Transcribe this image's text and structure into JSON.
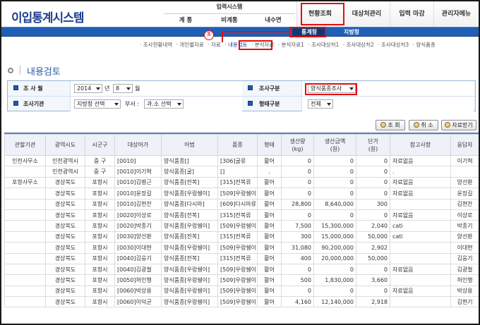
{
  "app": {
    "logo": "이입통계시스템"
  },
  "header": {
    "input_system": {
      "title": "입력시스템",
      "subs": [
        "계 통",
        "비계통",
        "내수면"
      ]
    },
    "menus": [
      "현황조회",
      "대상처관리",
      "입력 마감",
      "관리자메뉴"
    ]
  },
  "subnav": {
    "tabs": [
      "통계청",
      "지방청"
    ]
  },
  "annotation": {
    "marker": "①"
  },
  "breadcrumbs": [
    "· 조사현황내역",
    "· 개인별자료",
    "· 자료",
    "· 내용검토",
    "· 분석자료",
    "· 분석자료1",
    "· 조사대상처1",
    "· 조사대상처2",
    "· 조사대상처3",
    "· 양식품종"
  ],
  "page_title": "내용검토",
  "search": {
    "survey_month_label": "조 사 월",
    "year_value": "2014",
    "year_unit": "년",
    "month_value": "8",
    "month_unit": "월",
    "survey_type_label": "조사구분",
    "survey_type_value": "양식품종조사",
    "agency_label": "조사기관",
    "agency_value": "지방청 선택",
    "dept_label": "부서 :",
    "dept_value": "과.소 선택",
    "form_type_label": "형태구분",
    "form_type_value": "전체"
  },
  "buttons": {
    "search": "조 회",
    "cancel": "취 소",
    "download": "자료받기"
  },
  "table": {
    "headers": [
      "관할기관",
      "광역시도",
      "시군구",
      "대상어가",
      "어법",
      "품종",
      "형태",
      "생산량\n(kg)",
      "생산금액\n(원)",
      "단가\n(원)",
      "참고사항",
      "응답자"
    ],
    "rows": [
      [
        "인천사무소",
        "인천광역시",
        "중 구",
        "[0010]",
        "양식품종[]",
        "[306]굴류",
        "활어",
        "0",
        "0",
        "0",
        "자료없음",
        "이기혁"
      ],
      [
        "",
        "인천광역시",
        "중 구",
        "[0010]이기혁",
        "양식품종[굴]",
        "[]",
        ".",
        "0",
        "0",
        "0",
        ".",
        ""
      ],
      [
        "포항사무소",
        "경상북도",
        "포항시",
        "[0010]김병근",
        "양식품종[전복]",
        "[315]전복류",
        "활어",
        "0",
        "0",
        "0",
        "자료없음",
        "양선환"
      ],
      [
        "",
        "경상북도",
        "포항시",
        "[0010]윤장길",
        "양식품종[우렁쉥이]",
        "[509]우렁쉥이",
        "활어",
        "0",
        "0",
        "0",
        "자료없음",
        "윤장길"
      ],
      [
        "",
        "경상북도",
        "포항시",
        "[0010]김현찬",
        "양식품종[다시마]",
        "[609]다시마류",
        "활어",
        "28,800",
        "8,640,000",
        "300",
        "",
        "김현찬"
      ],
      [
        "",
        "경상북도",
        "포항시",
        "[0020]이상로",
        "양식품종[전복]",
        "[315]전복류",
        "활어",
        "0",
        "0",
        "0",
        "자료없음",
        "이상로"
      ],
      [
        "",
        "경상북도",
        "포항시",
        "[0020]박종기",
        "양식품종[우렁쉥이]",
        "[509]우렁쉥이",
        "활어",
        "7,500",
        "15,300,000",
        "2,040",
        "cati",
        "박종기"
      ],
      [
        "",
        "경상북도",
        "포항시",
        "[0030]양선환",
        "양식품종[전복]",
        "[315]전복류",
        "활어",
        "300",
        "15,000,000",
        "50,000",
        "cati",
        "양선환"
      ],
      [
        "",
        "경상북도",
        "포항시",
        "[0030]이대현",
        "양식품종[우렁쉥이]",
        "[509]우렁쉥이",
        "활어",
        "31,080",
        "90,200,000",
        "2,902",
        "",
        "이대현"
      ],
      [
        "",
        "경상북도",
        "포항시",
        "[0040]김웅기",
        "양식품종[전복]",
        "[315]전복류",
        "활어",
        "400",
        "20,000,000",
        "50,000",
        "",
        "김웅기"
      ],
      [
        "",
        "경상북도",
        "포항시",
        "[0040]김광철",
        "양식품종[우렁쉥이]",
        "[509]우렁쉥이",
        "활어",
        "0",
        "0",
        "0",
        "자료없음",
        "김광철"
      ],
      [
        "",
        "경상북도",
        "포항시",
        "[0050]허인행",
        "양식품종[우렁쉥이]",
        "[509]우렁쉥이",
        "활어",
        "500",
        "1,830,000",
        "3,660",
        "",
        "허인행"
      ],
      [
        "",
        "경상북도",
        "포항시",
        "[0060]박상용",
        "양식품종[우렁쉥이]",
        "[509]우렁쉥이",
        "활어",
        "0",
        "0",
        "0",
        "자료없음",
        "박상용"
      ],
      [
        "",
        "경상북도",
        "포항시",
        "[0060]이덕균",
        "양식품종[우렁쉥이]",
        "[509]우렁쉥이",
        "활어",
        "4,160",
        "12,140,000",
        "2,918",
        "",
        "김현기"
      ]
    ]
  },
  "colors": {
    "accent": "#1f5fb6",
    "annotation": "#e01010",
    "title": "#2b5aa3"
  }
}
